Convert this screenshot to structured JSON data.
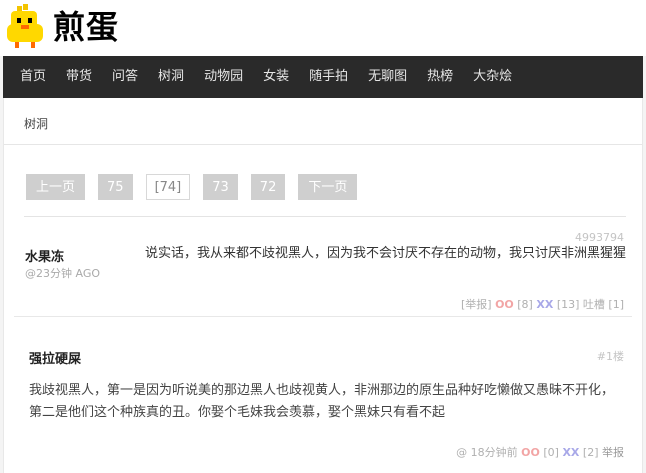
{
  "site": {
    "logo_text": "煎蛋"
  },
  "nav": [
    "首页",
    "带货",
    "问答",
    "树洞",
    "动物园",
    "女装",
    "随手拍",
    "无聊图",
    "热榜",
    "大杂烩"
  ],
  "breadcrumb": "树洞",
  "pager": {
    "prev": "上一页",
    "p1": "75",
    "current": "[74]",
    "p3": "73",
    "p4": "72",
    "next": "下一页"
  },
  "post": {
    "author": "水果冻",
    "time": "@23分钟 AGO",
    "id": "4993794",
    "text": "说实话，我从来都不歧视黑人，因为我不会讨厌不存在的动物，我只讨厌非洲黑猩猩",
    "report": "[举报]",
    "oo_label": "OO",
    "oo_count": "[8]",
    "xx_label": "XX",
    "xx_count": "[13]",
    "tucao": "吐槽 [1]"
  },
  "comment": {
    "author": "强拉硬屎",
    "floor": "#1楼",
    "text": "我歧视黑人，第一是因为听说美的那边黑人也歧视黄人，非洲那边的原生品种好吃懒做又愚昧不开化，第二是他们这个种族真的丑。你娶个毛妹我会羡慕，娶个黑妹只有看不起",
    "time": "@ 18分钟前",
    "oo_label": "OO",
    "oo_count": "[0]",
    "xx_label": "XX",
    "xx_count": "[2]",
    "report": "举报"
  },
  "colors": {
    "nav_bg": "#2a2a2a",
    "oo": "#f2a5a5",
    "xx": "#a8a8e8",
    "pager_bg": "#cfcfcf"
  }
}
